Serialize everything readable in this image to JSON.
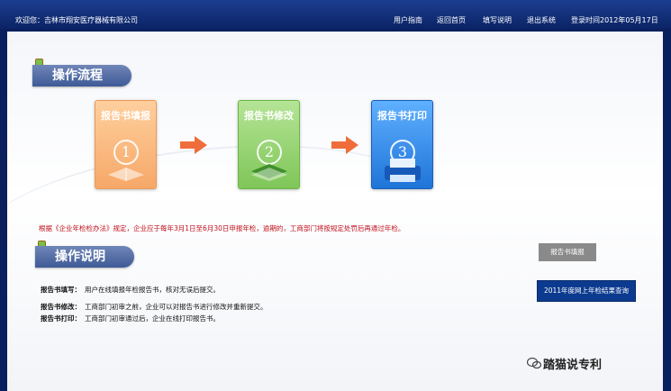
{
  "topbar": {
    "welcome": "欢迎您：吉林市翔安医疗器械有限公司",
    "nav": [
      "用户指南",
      "返回首页",
      "填写说明",
      "退出系统"
    ],
    "login_time": "登录时间2012年05月17日"
  },
  "process": {
    "title": "操作流程",
    "steps": [
      {
        "label": "报告书填报",
        "num": "1"
      },
      {
        "label": "报告书修改",
        "num": "2"
      },
      {
        "label": "报告书打印",
        "num": "3"
      }
    ]
  },
  "notice": "根据《企业年检检办法》规定，企业应于每年3月1日至6月30日申报年检，逾期的，工商部门将按规定处罚后再通过年检。",
  "help": {
    "title": "操作说明",
    "rows": [
      {
        "term": "报告书填写：",
        "desc": "用户在线填报年检报告书，核对无误后提交。"
      },
      {
        "term": "报告书修改：",
        "desc": "工商部门初审之前，企业可以对报告书进行修改并重新提交。"
      },
      {
        "term": "报告书打印：",
        "desc": "工商部门初审通过后，企业在线打印报告书。"
      }
    ]
  },
  "side": {
    "report_btn": "报告书填报",
    "query_btn": "2011年度网上年检结果查询"
  },
  "watermark": "踏猫说专利",
  "colors": {
    "header": "#0b2466",
    "notice": "#c0111b",
    "step1": "#f6a868",
    "step2": "#8fd06a",
    "step3": "#2f86e8"
  }
}
